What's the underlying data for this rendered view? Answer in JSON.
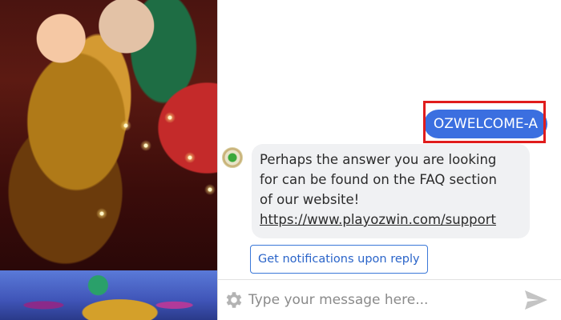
{
  "messages": {
    "user_message": "OZWELCOME-A",
    "bot_reply": {
      "line1": "Perhaps the answer you are looking",
      "line2": "for can be found on the FAQ section",
      "line3": "of our website!",
      "link": "https://www.playozwin.com/support"
    }
  },
  "actions": {
    "notify_label": "Get notifications upon reply"
  },
  "composer": {
    "placeholder": "Type your message here..."
  },
  "icons": {
    "settings": "gear-icon",
    "send": "send-icon",
    "bot_avatar": "bot-avatar-icon"
  },
  "colors": {
    "user_bubble": "#3b6fe0",
    "bot_bubble": "#f0f1f3",
    "highlight": "#e01c1c",
    "link_button": "#2a64c9"
  }
}
